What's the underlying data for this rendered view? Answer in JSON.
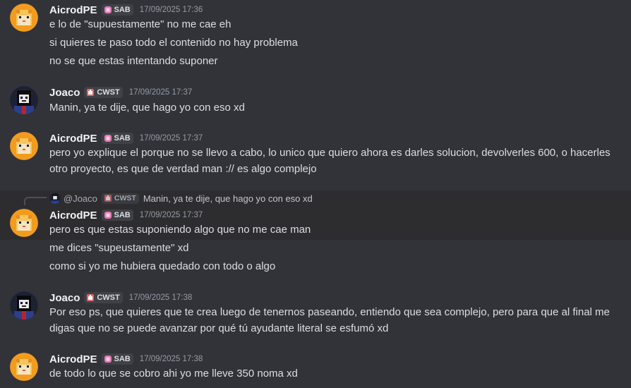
{
  "colors": {
    "background": "#323339",
    "highlight_background": "#2d2d30",
    "username": "#f2f3f5",
    "timestamp": "#949ba4",
    "sab_tag_icon": "#e47ab4",
    "cwst_tag_icon": "#e06767"
  },
  "messages": [
    {
      "author": "AicrodPE",
      "tag": "SAB",
      "timestamp": "17/09/2025 17:36",
      "avatar_icon": "cat-avatar-icon",
      "lines": [
        "e lo de \"supuestamente\" no me cae eh",
        "si quieres te paso todo el contenido no hay problema",
        "no se que estas intentando suponer"
      ]
    },
    {
      "author": "Joaco",
      "tag": "CWST",
      "timestamp": "17/09/2025 17:37",
      "avatar_icon": "dark-character-avatar-icon",
      "lines": [
        "Manin, ya te dije, que hago yo con eso xd"
      ]
    },
    {
      "author": "AicrodPE",
      "tag": "SAB",
      "timestamp": "17/09/2025 17:37",
      "avatar_icon": "cat-avatar-icon",
      "lines": [
        "pero yo explique el porque no se llevo a cabo, lo unico que quiero ahora es darles solucion, devolverles 600, o hacerles",
        "otro proyecto, es que de verdad man :// es algo complejo"
      ]
    },
    {
      "author": "AicrodPE",
      "tag": "SAB",
      "timestamp": "17/09/2025 17:37",
      "avatar_icon": "cat-avatar-icon",
      "reply": {
        "author": "@Joaco",
        "tag": "CWST",
        "text": "Manin, ya te dije, que hago yo con eso xd"
      },
      "lines": [
        "pero es que estas suponiendo algo que no me cae man",
        "me dices \"supeustamente\" xd",
        "como si yo me hubiera quedado con todo o algo"
      ]
    },
    {
      "author": "Joaco",
      "tag": "CWST",
      "timestamp": "17/09/2025 17:38",
      "avatar_icon": "dark-character-avatar-icon",
      "lines": [
        "Por eso ps, que quieres que te crea luego de tenernos paseando, entiendo que sea complejo, pero para que al final me",
        "digas que no se puede avanzar por qué tú ayudante literal se esfumó xd"
      ]
    },
    {
      "author": "AicrodPE",
      "tag": "SAB",
      "timestamp": "17/09/2025 17:38",
      "avatar_icon": "cat-avatar-icon",
      "lines": [
        "de todo lo que se cobro ahi yo me  lleve 350 noma xd"
      ]
    }
  ]
}
